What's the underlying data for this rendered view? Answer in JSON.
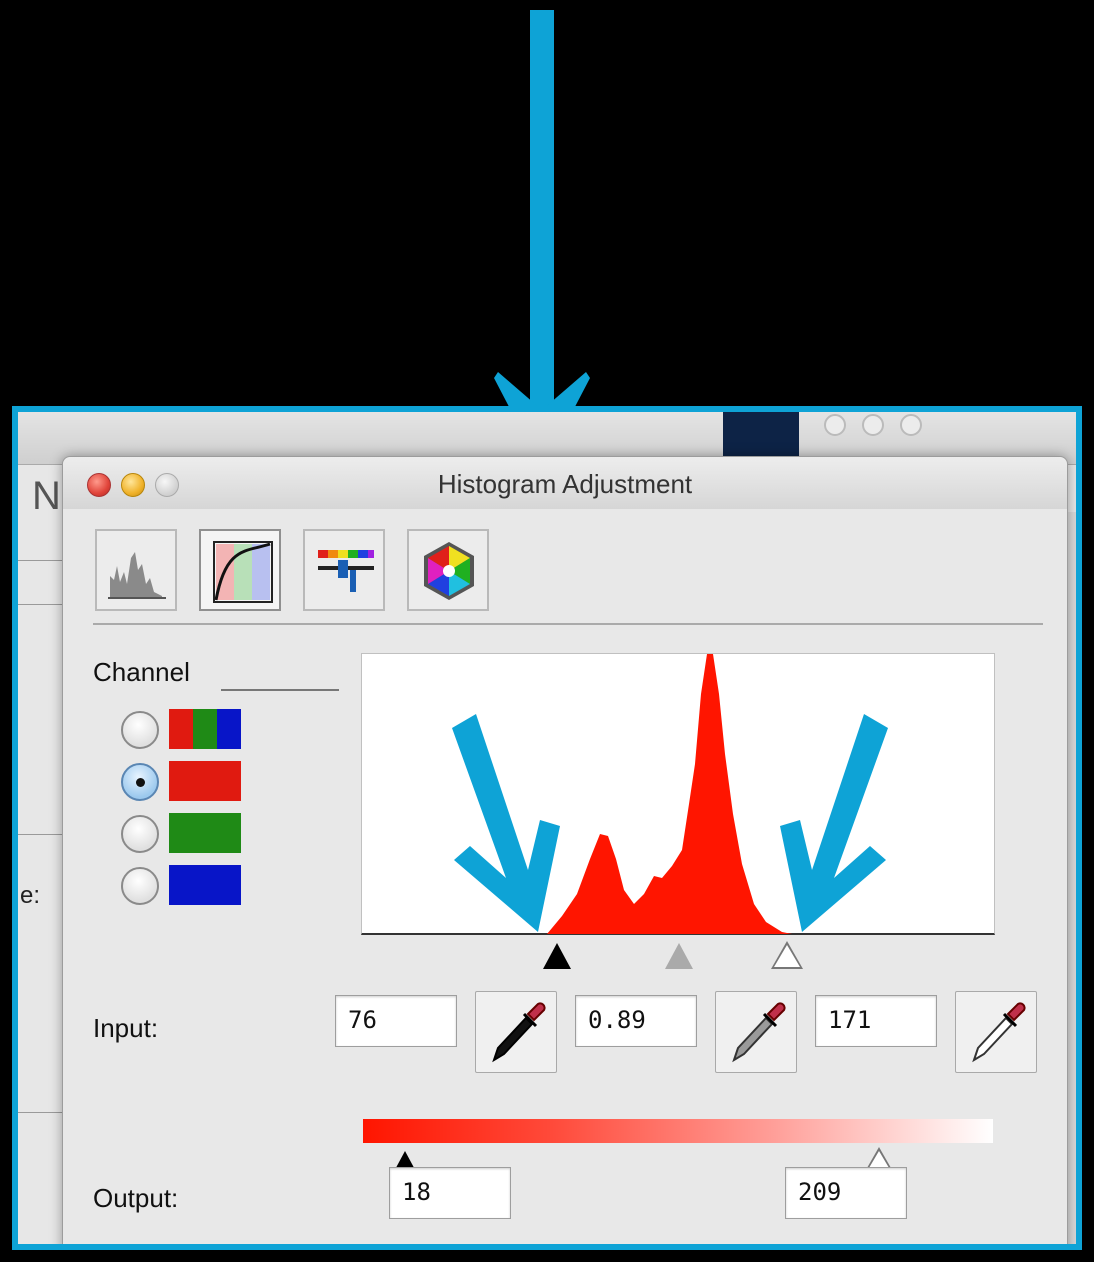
{
  "dialog": {
    "title": "Histogram Adjustment",
    "toolbar": [
      "histogram-icon",
      "curves-icon",
      "levels-slider-icon",
      "color-wheel-icon"
    ],
    "channel_label": "Channel",
    "channels": [
      {
        "name": "rgb",
        "selected": false
      },
      {
        "name": "red",
        "selected": true
      },
      {
        "name": "green",
        "selected": false
      },
      {
        "name": "blue",
        "selected": false
      }
    ],
    "input_label": "Input:",
    "input_black": "76",
    "input_gamma": "0.89",
    "input_white": "171",
    "output_label": "Output:",
    "output_black": "18",
    "output_white": "209"
  },
  "background_window": {
    "label_fragment": "e:",
    "title_fragment": "N"
  },
  "colors": {
    "highlight": "#0ea3d6",
    "histogram_fill": "#ff1500",
    "red": "#e01a10",
    "green": "#1f8a16",
    "blue": "#0815c8"
  }
}
